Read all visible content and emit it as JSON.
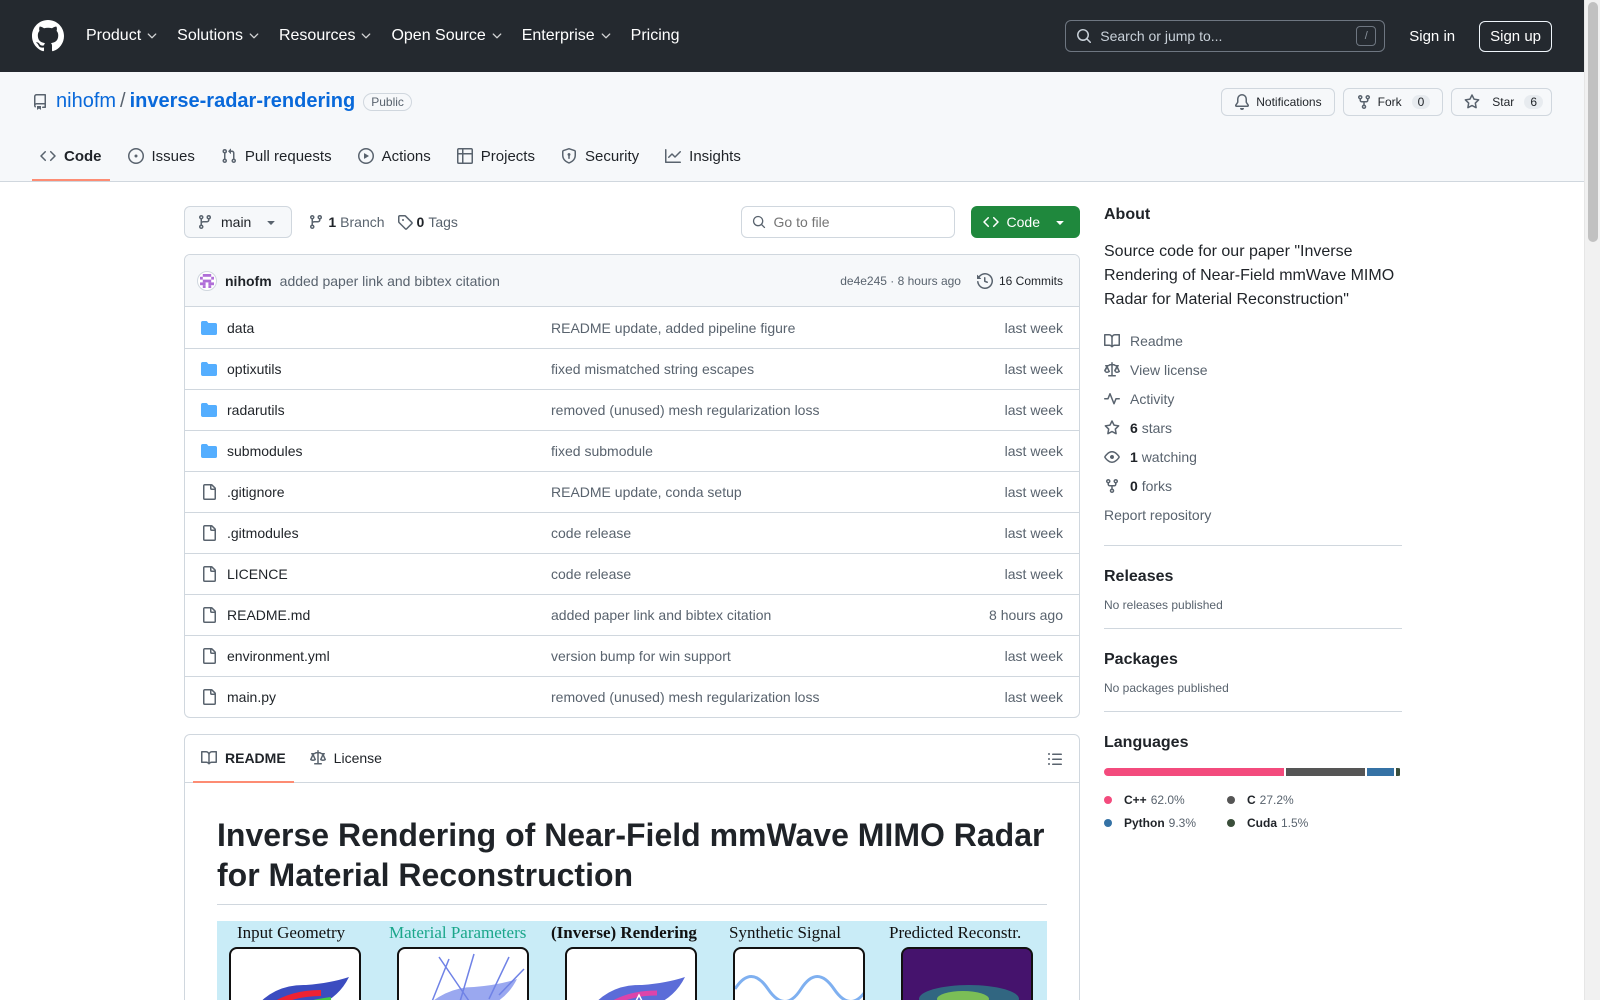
{
  "header": {
    "nav": [
      "Product",
      "Solutions",
      "Resources",
      "Open Source",
      "Enterprise",
      "Pricing"
    ],
    "search_placeholder": "Search or jump to...",
    "search_key": "/",
    "sign_in": "Sign in",
    "sign_up": "Sign up"
  },
  "repo": {
    "owner": "nihofm",
    "separator": "/",
    "name": "inverse-radar-rendering",
    "visibility": "Public",
    "notifications": "Notifications",
    "fork_label": "Fork",
    "fork_count": "0",
    "star_label": "Star",
    "star_count": "6",
    "tabs": [
      "Code",
      "Issues",
      "Pull requests",
      "Actions",
      "Projects",
      "Security",
      "Insights"
    ]
  },
  "toolbar": {
    "branch": "main",
    "branch_count": "1",
    "branch_label": "Branch",
    "tag_count": "0",
    "tag_label": "Tags",
    "goto_placeholder": "Go to file",
    "code_label": "Code"
  },
  "commit": {
    "author": "nihofm",
    "message": "added paper link and bibtex citation",
    "sha_time": "de4e245 · 8 hours ago",
    "commits": "16 Commits"
  },
  "files": [
    {
      "name": "data",
      "type": "dir",
      "message": "README update, added pipeline figure",
      "date": "last week"
    },
    {
      "name": "optixutils",
      "type": "dir",
      "message": "fixed mismatched string escapes",
      "date": "last week"
    },
    {
      "name": "radarutils",
      "type": "dir",
      "message": "removed (unused) mesh regularization loss",
      "date": "last week"
    },
    {
      "name": "submodules",
      "type": "dir",
      "message": "fixed submodule",
      "date": "last week"
    },
    {
      "name": ".gitignore",
      "type": "file",
      "message": "README update, conda setup",
      "date": "last week"
    },
    {
      "name": ".gitmodules",
      "type": "file",
      "message": "code release",
      "date": "last week"
    },
    {
      "name": "LICENCE",
      "type": "file",
      "message": "code release",
      "date": "last week"
    },
    {
      "name": "README.md",
      "type": "file",
      "message": "added paper link and bibtex citation",
      "date": "8 hours ago"
    },
    {
      "name": "environment.yml",
      "type": "file",
      "message": "version bump for win support",
      "date": "last week"
    },
    {
      "name": "main.py",
      "type": "file",
      "message": "removed (unused) mesh regularization loss",
      "date": "last week"
    }
  ],
  "readme": {
    "tab_readme": "README",
    "tab_license": "License",
    "title": "Inverse Rendering of Near-Field mmWave MIMO Radar for Material Reconstruction",
    "pipeline_labels": [
      "Input Geometry",
      "Material Parameters",
      "(Inverse) Rendering",
      "Synthetic Signal",
      "Predicted Reconstr."
    ],
    "pipeline_label_colors": [
      "#111111",
      "#1aa68a",
      "#111111",
      "#111111",
      "#111111"
    ]
  },
  "about": {
    "heading": "About",
    "description": "Source code for our paper \"Inverse Rendering of Near-Field mmWave MIMO Radar for Material Reconstruction\"",
    "readme": "Readme",
    "license": "View license",
    "activity": "Activity",
    "stars_count": "6",
    "stars_label": "stars",
    "watching_count": "1",
    "watching_label": "watching",
    "forks_count": "0",
    "forks_label": "forks",
    "report": "Report repository"
  },
  "releases": {
    "heading": "Releases",
    "text": "No releases published"
  },
  "packages": {
    "heading": "Packages",
    "text": "No packages published"
  },
  "languages": {
    "heading": "Languages",
    "items": [
      {
        "name": "C++",
        "percent": "62.0%",
        "value": 62.0,
        "color": "#f34b7d"
      },
      {
        "name": "C",
        "percent": "27.2%",
        "value": 27.2,
        "color": "#555555"
      },
      {
        "name": "Python",
        "percent": "9.3%",
        "value": 9.3,
        "color": "#3572A5"
      },
      {
        "name": "Cuda",
        "percent": "1.5%",
        "value": 1.5,
        "color": "#3A4E3A"
      }
    ]
  }
}
